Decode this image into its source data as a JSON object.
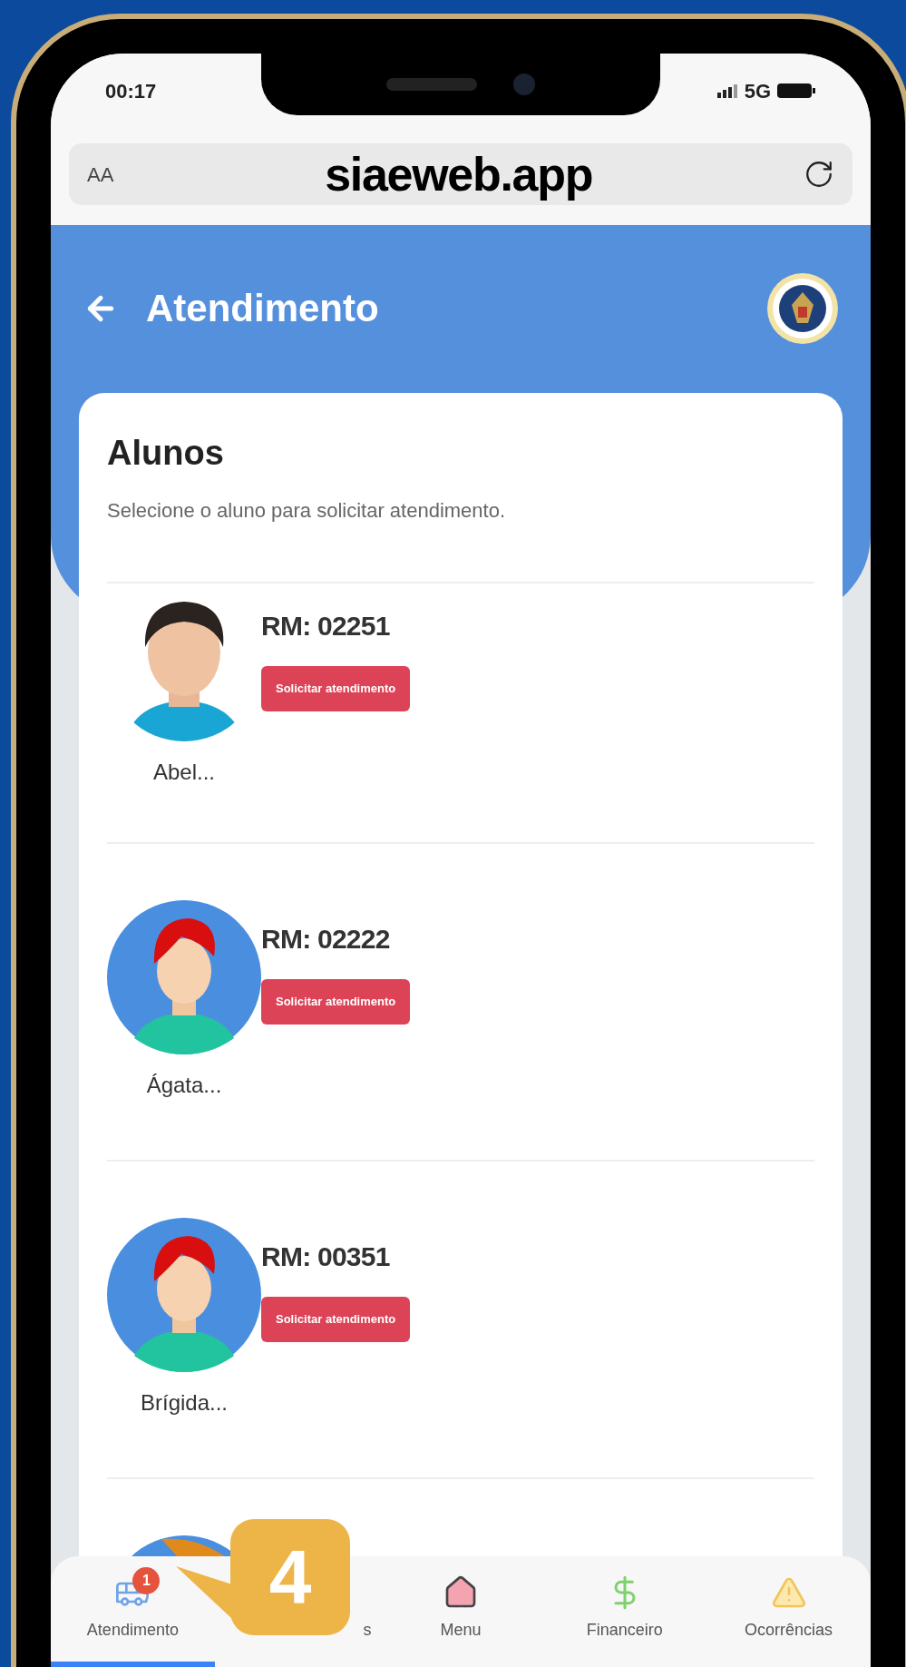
{
  "status_bar": {
    "time": "00:17",
    "network": "5G"
  },
  "browser": {
    "text_size": "AA",
    "url": "siaeweb.app"
  },
  "header": {
    "title": "Atendimento"
  },
  "card": {
    "title": "Alunos",
    "subtitle": "Selecione o aluno para solicitar atendimento."
  },
  "students": [
    {
      "rm": "RM: 02251",
      "button": "Solicitar atendimento",
      "name": "Abel..."
    },
    {
      "kind": "illustration",
      "rm": "RM: 02222",
      "button": "Solicitar atendimento",
      "name": "Ágata..."
    },
    {
      "kind": "illustration",
      "rm": "RM: 00351",
      "button": "Solicitar atendimento",
      "name": "Brígida..."
    },
    {
      "kind": "cut"
    }
  ],
  "bottom_nav": [
    {
      "kind": "service",
      "label": "Atendimento",
      "badge": "1",
      "selected": true
    },
    {
      "kind": "covered",
      "label": "s",
      "selected": false
    },
    {
      "kind": "home",
      "label": "Menu",
      "selected": false
    },
    {
      "kind": "money",
      "label": "Financeiro",
      "selected": false
    },
    {
      "kind": "warning",
      "label": "Ocorrências",
      "selected": false
    }
  ],
  "callout": {
    "step": "4"
  }
}
